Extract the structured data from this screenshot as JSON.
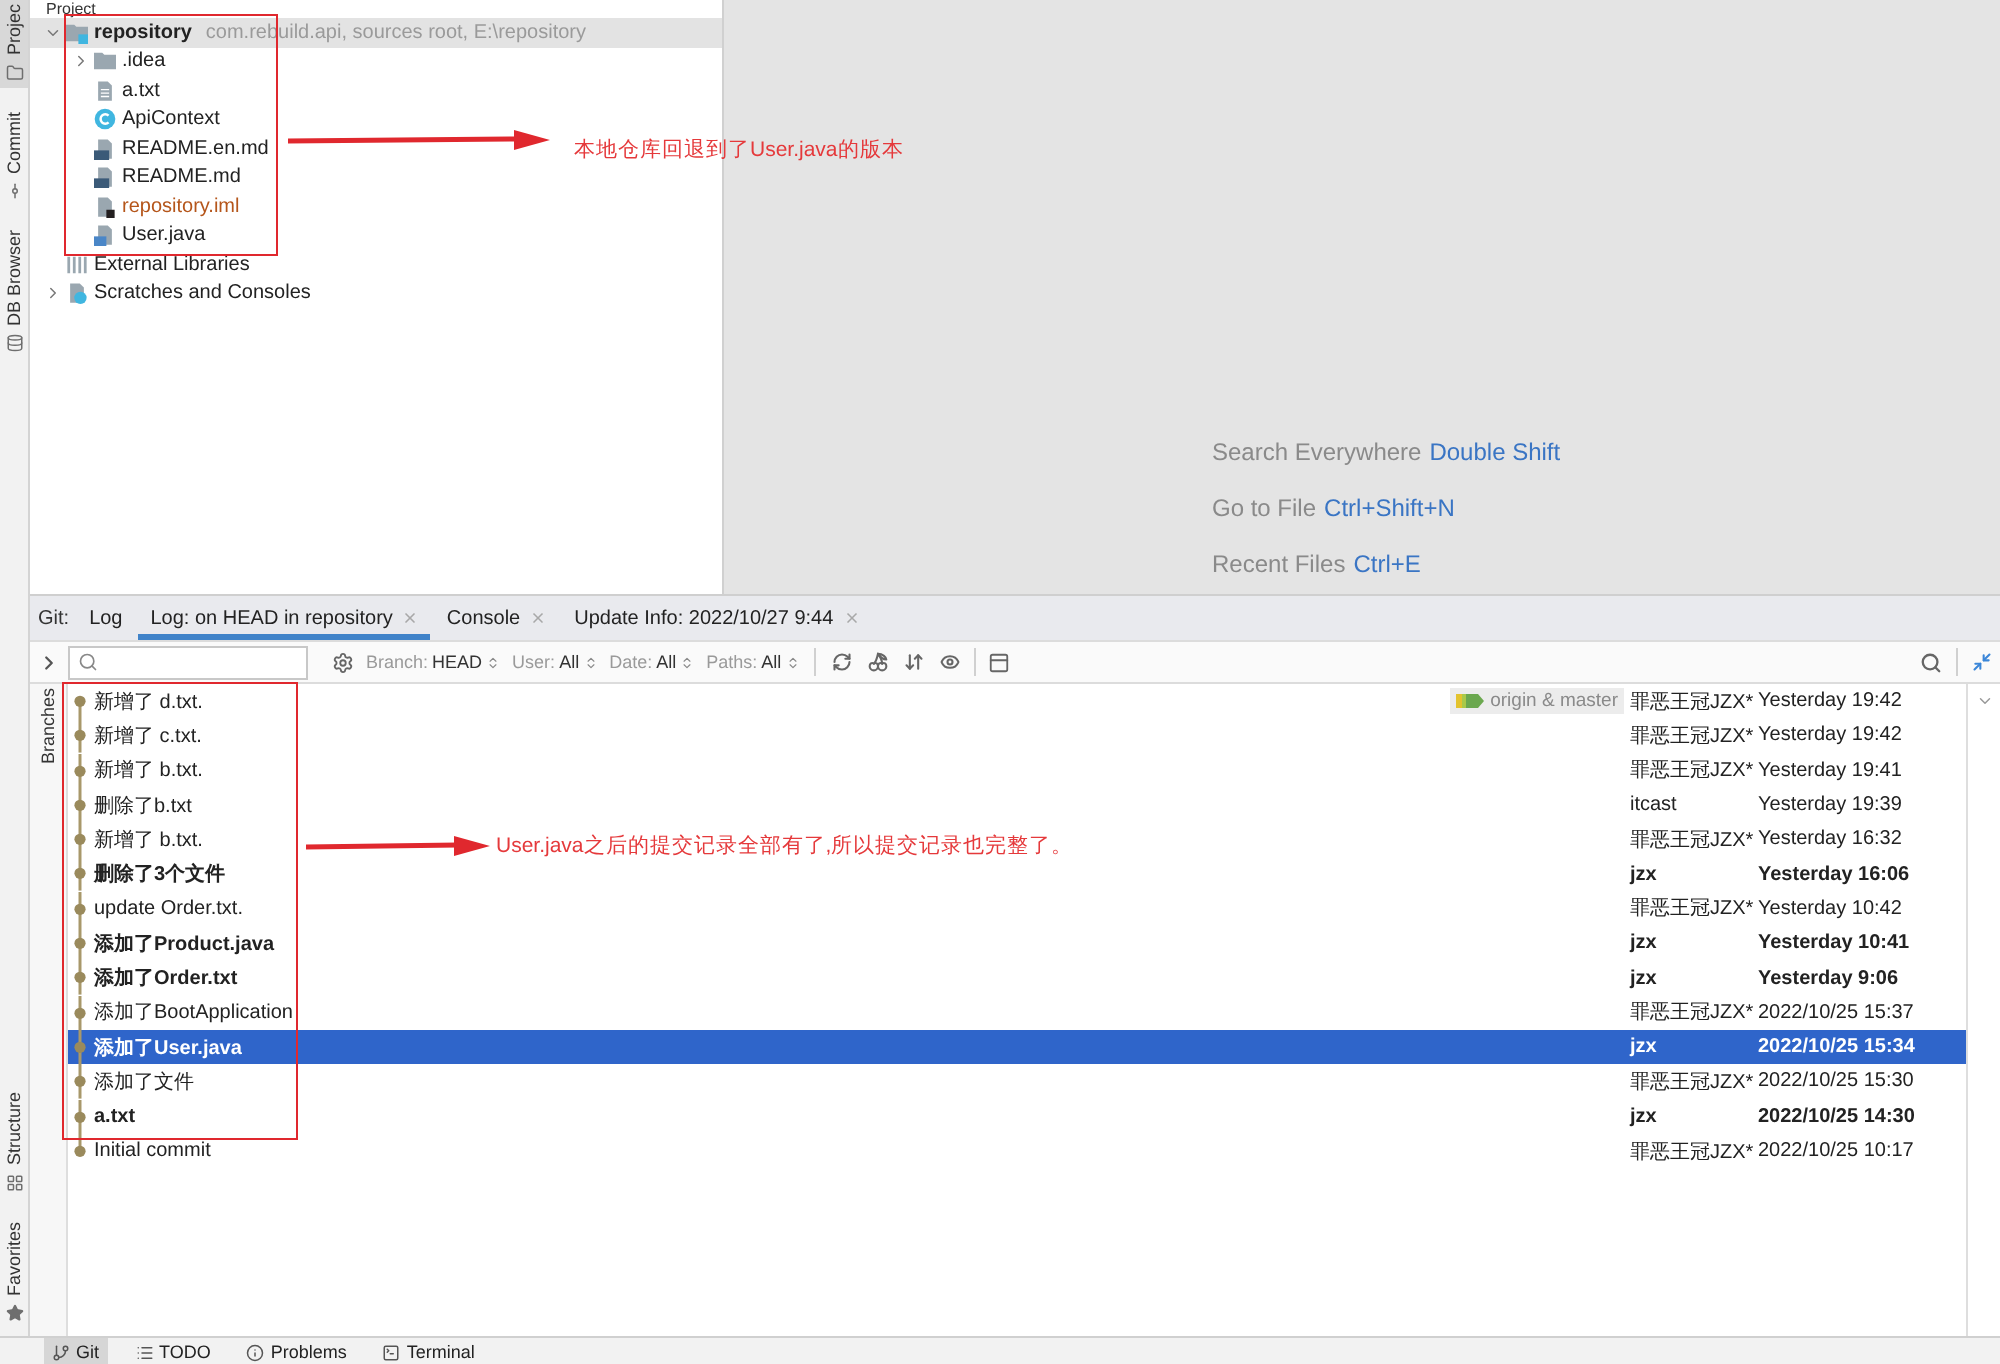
{
  "tool_window_bar": {
    "top": [
      {
        "label": "Projec",
        "kind": "project",
        "selected": true
      },
      {
        "label": "Commit",
        "kind": "commit",
        "selected": false
      },
      {
        "label": "DB Browser",
        "kind": "database",
        "selected": false
      }
    ],
    "bottom": [
      {
        "label": "Structure",
        "kind": "structure",
        "selected": false
      },
      {
        "label": "Favorites",
        "kind": "favorites",
        "selected": false
      }
    ]
  },
  "project_panel": {
    "title": "Project",
    "tree": [
      {
        "name": "repository",
        "hint": "com.rebuild.api, sources root, E:\\repository",
        "kind": "module",
        "expanded": true,
        "selected": true,
        "unversioned": false,
        "children": [
          {
            "name": ".idea",
            "kind": "folder",
            "expanded": false,
            "selected": false,
            "unversioned": false
          },
          {
            "name": "a.txt",
            "kind": "text",
            "selected": false,
            "unversioned": false
          },
          {
            "name": "ApiContext",
            "kind": "class",
            "selected": false,
            "unversioned": false
          },
          {
            "name": "README.en.md",
            "kind": "markdown",
            "selected": false,
            "unversioned": false
          },
          {
            "name": "README.md",
            "kind": "markdown",
            "selected": false,
            "unversioned": false
          },
          {
            "name": "repository.iml",
            "kind": "iml",
            "selected": false,
            "unversioned": true
          },
          {
            "name": "User.java",
            "kind": "java",
            "selected": false,
            "unversioned": false
          }
        ]
      },
      {
        "name": "External Libraries",
        "kind": "libraries",
        "selected": false,
        "unversioned": false
      },
      {
        "name": "Scratches and Consoles",
        "kind": "scratches",
        "expanded": false,
        "selected": false,
        "unversioned": false
      }
    ],
    "annotation": "本地仓库回退到了User.java的版本"
  },
  "editor": {
    "hints": [
      {
        "action": "Search Everywhere",
        "shortcut": "Double Shift"
      },
      {
        "action": "Go to File",
        "shortcut": "Ctrl+Shift+N"
      },
      {
        "action": "Recent Files",
        "shortcut": "Ctrl+E"
      }
    ]
  },
  "git_panel": {
    "label": "Git:",
    "tabs": [
      {
        "label": "Log",
        "selected": false,
        "closable": false
      },
      {
        "label": "Log: on HEAD in repository",
        "selected": true,
        "closable": true
      },
      {
        "label": "Console",
        "selected": false,
        "closable": true
      },
      {
        "label": "Update Info: 2022/10/27 9:44",
        "selected": false,
        "closable": true
      }
    ],
    "filters": [
      {
        "name": "Branch:",
        "value": "HEAD"
      },
      {
        "name": "User:",
        "value": "All"
      },
      {
        "name": "Date:",
        "value": "All"
      },
      {
        "name": "Paths:",
        "value": "All"
      }
    ],
    "side_tab": "Branches",
    "commits": [
      {
        "message": "新增了 d.txt.",
        "refs": "origin & master",
        "author": "罪恶王冠JZX*",
        "date": "Yesterday 19:42",
        "bold": false,
        "selected": false
      },
      {
        "message": "新增了 c.txt.",
        "author": "罪恶王冠JZX*",
        "date": "Yesterday 19:42",
        "bold": false,
        "selected": false
      },
      {
        "message": "新增了 b.txt.",
        "author": "罪恶王冠JZX*",
        "date": "Yesterday 19:41",
        "bold": false,
        "selected": false
      },
      {
        "message": "删除了b.txt",
        "author": "itcast",
        "date": "Yesterday 19:39",
        "bold": false,
        "selected": false
      },
      {
        "message": "新增了 b.txt.",
        "author": "罪恶王冠JZX*",
        "date": "Yesterday 16:32",
        "bold": false,
        "selected": false
      },
      {
        "message": "删除了3个文件",
        "author": "jzx",
        "date": "Yesterday 16:06",
        "bold": true,
        "selected": false
      },
      {
        "message": "update Order.txt.",
        "author": "罪恶王冠JZX*",
        "date": "Yesterday 10:42",
        "bold": false,
        "selected": false
      },
      {
        "message": "添加了Product.java",
        "author": "jzx",
        "date": "Yesterday 10:41",
        "bold": true,
        "selected": false
      },
      {
        "message": "添加了Order.txt",
        "author": "jzx",
        "date": "Yesterday 9:06",
        "bold": true,
        "selected": false
      },
      {
        "message": "添加了BootApplication",
        "author": "罪恶王冠JZX*",
        "date": "2022/10/25 15:37",
        "bold": false,
        "selected": false
      },
      {
        "message": "添加了User.java",
        "author": "jzx",
        "date": "2022/10/25 15:34",
        "bold": true,
        "selected": true
      },
      {
        "message": "添加了文件",
        "author": "罪恶王冠JZX*",
        "date": "2022/10/25 15:30",
        "bold": false,
        "selected": false
      },
      {
        "message": "a.txt",
        "author": "jzx",
        "date": "2022/10/25 14:30",
        "bold": true,
        "selected": false
      },
      {
        "message": "Initial commit",
        "author": "罪恶王冠JZX*",
        "date": "2022/10/25 10:17",
        "bold": false,
        "selected": false
      }
    ],
    "annotation": "User.java之后的提交记录全部有了,所以提交记录也完整了。"
  },
  "bottom_bar": [
    {
      "label": "Git",
      "kind": "git",
      "selected": true
    },
    {
      "label": "TODO",
      "kind": "todo",
      "selected": false
    },
    {
      "label": "Problems",
      "kind": "problems",
      "selected": false
    },
    {
      "label": "Terminal",
      "kind": "terminal",
      "selected": false
    }
  ]
}
